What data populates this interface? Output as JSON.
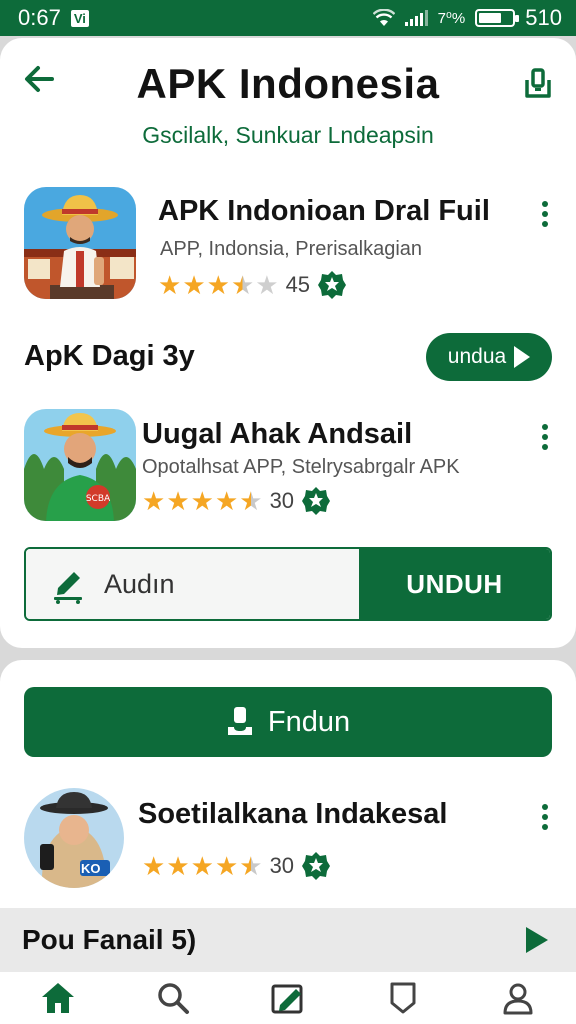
{
  "status_bar": {
    "time": "0:67",
    "sim_label": "Vi",
    "battery_percent": "7⁰%",
    "right_number": "510"
  },
  "header": {
    "title": "APK Indonesia",
    "subtitle": "Gscilalk, Sunkuar Lndeapsin",
    "back_icon": "arrow-left-icon",
    "share_icon": "share-icon"
  },
  "apps": [
    {
      "name": "APK Indonioan Dral Fuil",
      "description": "APP, Indonsia, Prerisalkagian",
      "rating_stars": 3.5,
      "rating_count": "45",
      "icon": "farmer-hat-avatar-icon"
    },
    {
      "name": "Uugal Ahak Andsail",
      "description": "Opotalhsat APP, Stelrysabrgalr APK",
      "rating_stars": 4.5,
      "rating_count": "30",
      "icon": "man-hat-avatar-icon"
    },
    {
      "name": "Soetilalkana Indakesal",
      "description": "",
      "rating_stars": 4.5,
      "rating_count": "30",
      "icon": "woman-hijab-avatar-icon",
      "icon_badge": "KO"
    }
  ],
  "section": {
    "title": "ApK Dagi 3y",
    "action_label": "undua"
  },
  "split_button": {
    "left_label": "Audın",
    "right_label": "UNDUH"
  },
  "primary_button": {
    "label": "Fndun"
  },
  "promo": {
    "label": "Pou Fanail 5)"
  },
  "nav": [
    "home-icon",
    "search-icon",
    "edit-icon",
    "bookmark-icon",
    "profile-icon"
  ],
  "colors": {
    "accent": "#0d6b3a",
    "star": "#f5a623"
  }
}
